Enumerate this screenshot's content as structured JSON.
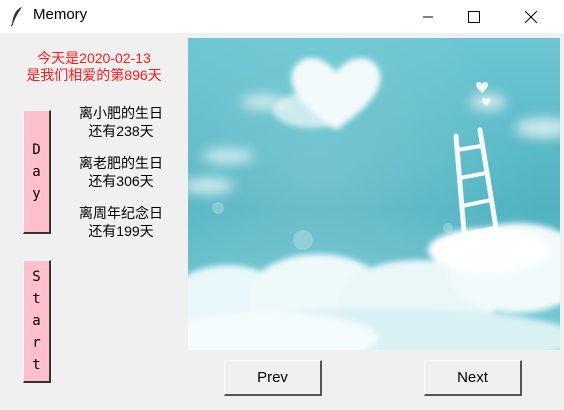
{
  "window": {
    "title": "Memory"
  },
  "header": {
    "today_line": "今天是2020-02-13",
    "love_line": "是我们相爱的第896天"
  },
  "sidebar": {
    "day_button": [
      "D",
      "a",
      "y"
    ],
    "start_button": [
      "S",
      "t",
      "a",
      "r",
      "t"
    ]
  },
  "countdowns": [
    {
      "event": "离小肥的生日",
      "remaining": "还有238天"
    },
    {
      "event": "离老肥的生日",
      "remaining": "还有306天"
    },
    {
      "event": "离周年纪念日",
      "remaining": "还有199天"
    }
  ],
  "nav": {
    "prev_label": "Prev",
    "next_label": "Next"
  },
  "colors": {
    "accent_red": "#ff1a1a",
    "button_pink": "#ffc0cb",
    "sky": "#5bbdc8"
  }
}
